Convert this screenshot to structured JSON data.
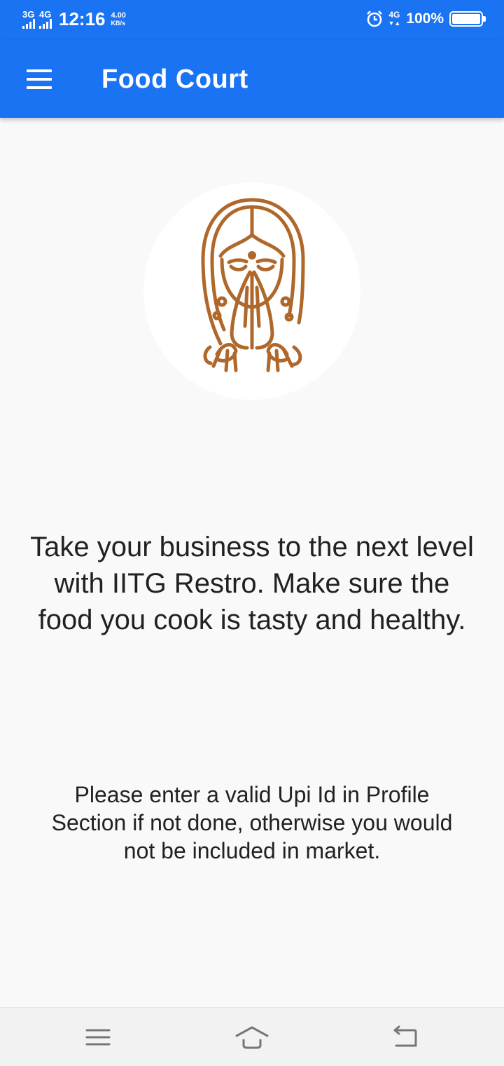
{
  "status_bar": {
    "network_1": "3G",
    "network_2": "4G",
    "time": "12:16",
    "speed_value": "4.00",
    "speed_unit": "KB/s",
    "network_right": "4G",
    "battery_percent": "100%",
    "battery_level": 1.0
  },
  "app_bar": {
    "title": "Food Court"
  },
  "hero": {
    "illustration": "namaste-woman-illustration",
    "accent_color": "#b0672a"
  },
  "main": {
    "headline": "Take your business to the next level with IITG Restro. Make sure the food you cook is tasty and healthy.",
    "notice": "Please enter a valid Upi Id in Profile Section if not done, otherwise you would not be included in market."
  },
  "colors": {
    "primary": "#1a73f2",
    "background": "#f9f9f9"
  }
}
